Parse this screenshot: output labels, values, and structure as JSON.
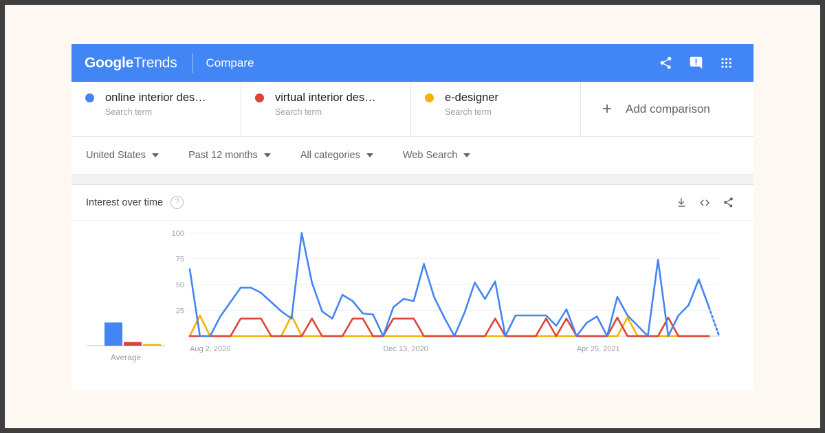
{
  "header": {
    "logo_bold": "Google",
    "logo_light": "Trends",
    "page_label": "Compare",
    "icons": [
      {
        "name": "share-icon",
        "glyph": "share"
      },
      {
        "name": "feedback-icon",
        "glyph": "feedback"
      },
      {
        "name": "apps-grid-icon",
        "glyph": "apps"
      }
    ]
  },
  "terms": [
    {
      "label": "online interior des…",
      "sub": "Search term",
      "color": "#4285f4"
    },
    {
      "label": "virtual interior des…",
      "sub": "Search term",
      "color": "#db4437"
    },
    {
      "label": "e-designer",
      "sub": "Search term",
      "color": "#f4b400"
    }
  ],
  "add_comparison": {
    "plus": "+",
    "label": "Add comparison"
  },
  "filters": [
    {
      "label": "United States"
    },
    {
      "label": "Past 12 months"
    },
    {
      "label": "All categories"
    },
    {
      "label": "Web Search"
    }
  ],
  "card": {
    "title": "Interest over time",
    "help_glyph": "?",
    "actions": [
      {
        "name": "download-icon"
      },
      {
        "name": "embed-code-icon"
      },
      {
        "name": "share-icon"
      }
    ]
  },
  "chart_data": {
    "type": "line",
    "title": "Interest over time",
    "xlabel": "",
    "ylabel": "",
    "ylim": [
      0,
      100
    ],
    "yticks": [
      25,
      50,
      75,
      100
    ],
    "grid": true,
    "legend_position": "top-chips",
    "xtick_labels": [
      "Aug 2, 2020",
      "Dec 13, 2020",
      "Apr 25, 2021"
    ],
    "xtick_indices": [
      0,
      19,
      38
    ],
    "n_points": 53,
    "partial_last_points": 2,
    "series": [
      {
        "name": "online interior des…",
        "color": "#4285f4",
        "values": [
          65,
          0,
          0,
          19,
          33,
          47,
          47,
          42,
          33,
          24,
          17,
          100,
          52,
          24,
          17,
          40,
          34,
          22,
          21,
          0,
          28,
          36,
          34,
          70,
          38,
          18,
          0,
          23,
          52,
          36,
          53,
          0,
          20,
          20,
          20,
          20,
          10,
          26,
          0,
          13,
          19,
          0,
          38,
          20,
          10,
          0,
          74,
          0,
          20,
          30,
          55,
          28,
          0
        ]
      },
      {
        "name": "virtual interior des…",
        "color": "#db4437",
        "values": [
          0,
          0,
          0,
          0,
          0,
          17,
          17,
          17,
          0,
          0,
          0,
          0,
          17,
          0,
          0,
          0,
          17,
          17,
          0,
          0,
          17,
          17,
          17,
          0,
          0,
          0,
          0,
          0,
          0,
          0,
          17,
          0,
          0,
          0,
          0,
          17,
          0,
          17,
          0,
          0,
          0,
          0,
          18,
          0,
          0,
          0,
          0,
          18,
          0,
          0,
          0,
          0,
          0
        ]
      },
      {
        "name": "e-designer",
        "color": "#f4b400",
        "values": [
          0,
          20,
          0,
          0,
          0,
          0,
          0,
          0,
          0,
          0,
          20,
          0,
          0,
          0,
          0,
          0,
          0,
          0,
          0,
          0,
          0,
          0,
          0,
          0,
          0,
          0,
          0,
          0,
          0,
          0,
          0,
          0,
          0,
          0,
          0,
          0,
          0,
          0,
          0,
          0,
          0,
          0,
          0,
          18,
          0,
          0,
          0,
          0,
          0,
          0,
          0,
          0,
          0
        ]
      }
    ],
    "average_chart": {
      "label": "Average",
      "type": "bar",
      "categories": [
        "online interior des…",
        "virtual interior des…",
        "e-designer"
      ],
      "values": [
        25,
        4,
        1
      ],
      "colors": [
        "#4285f4",
        "#db4437",
        "#f4b400"
      ]
    }
  }
}
